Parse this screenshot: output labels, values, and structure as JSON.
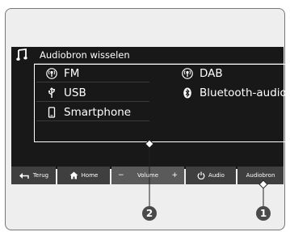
{
  "screen": {
    "title": "Audiobron wisselen",
    "sources": [
      {
        "label": "FM",
        "icon": "radio-antenna-icon"
      },
      {
        "label": "USB",
        "icon": "usb-icon"
      },
      {
        "label": "Smartphone",
        "icon": "smartphone-icon"
      },
      {
        "label": "DAB",
        "icon": "radio-antenna-icon"
      },
      {
        "label": "Bluetooth-audio",
        "icon": "bluetooth-icon"
      }
    ]
  },
  "buttons": {
    "back": "Terug",
    "home": "Home",
    "volume_minus": "−",
    "volume": "Volume",
    "volume_plus": "+",
    "audio": "Audio",
    "audio_source": "Audiobron"
  },
  "callouts": {
    "one": "1",
    "two": "2"
  }
}
